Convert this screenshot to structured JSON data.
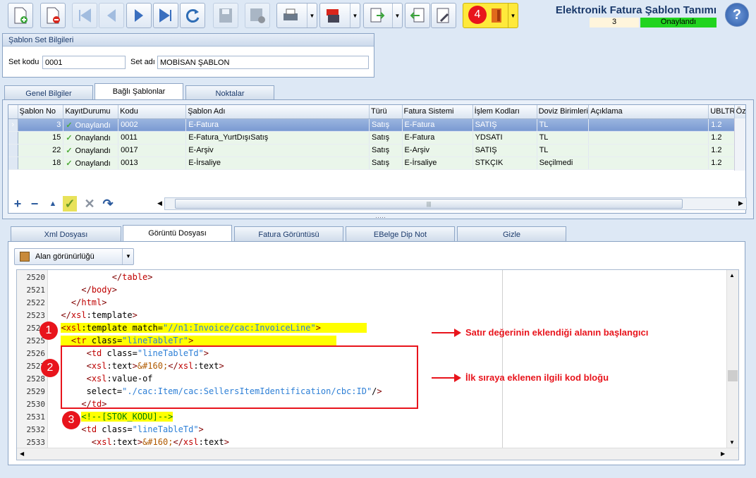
{
  "app": {
    "title": "Elektronik Fatura Şablon Tanımı",
    "record_no": "3",
    "status": "Onaylandı",
    "status_color": "#21d41f"
  },
  "toolbar": {
    "buttons": [
      "new-document-icon",
      "delete-document-icon",
      "first-record-icon",
      "previous-record-icon",
      "next-record-icon",
      "last-record-icon",
      "refresh-icon",
      "save-icon",
      "save-close-icon",
      "print-icon",
      "pdf-save-icon",
      "export-icon",
      "import-icon",
      "settings-icon",
      "exit-door-icon",
      "help-icon"
    ],
    "badge_4": "4"
  },
  "set_group": {
    "header": "Şablon Set Bilgileri",
    "set_kodu_label": "Set kodu",
    "set_kodu_value": "0001",
    "set_adi_label": "Set adı",
    "set_adi_value": "MOBİSAN ŞABLON"
  },
  "main_tabs": [
    "Genel Bilgiler",
    "Bağlı Şablonlar",
    "Noktalar"
  ],
  "grid": {
    "columns": [
      "Şablon No",
      "KayıtDurumu",
      "Kodu",
      "Şablon Adı",
      "Türü",
      "Fatura Sistemi",
      "İşlem Kodları",
      "Doviz Birimleri",
      "Açıklama",
      "UBLTR",
      "Özel I"
    ],
    "rows": [
      {
        "no": "3",
        "status": "Onaylandı",
        "code": "0002",
        "name": "E-Fatura",
        "type": "Satış",
        "system": "E-Fatura",
        "ops": "SATIŞ",
        "currency": "TL",
        "desc": "",
        "ubl": "1.2"
      },
      {
        "no": "15",
        "status": "Onaylandı",
        "code": "0011",
        "name": "E-Fatura_YurtDışıSatış",
        "type": "Satış",
        "system": "E-Fatura",
        "ops": "YDSATI",
        "currency": "TL",
        "desc": "",
        "ubl": "1.2"
      },
      {
        "no": "22",
        "status": "Onaylandı",
        "code": "0017",
        "name": "E-Arşiv",
        "type": "Satış",
        "system": "E-Arşiv",
        "ops": "SATIŞ",
        "currency": "TL",
        "desc": "",
        "ubl": "1.2"
      },
      {
        "no": "18",
        "status": "Onaylandı",
        "code": "0013",
        "name": "E-İrsaliye",
        "type": "Satış",
        "system": "E-İrsaliye",
        "ops": "STKÇIK",
        "currency": "Seçilmedi",
        "desc": "",
        "ubl": "1.2"
      }
    ]
  },
  "lower_tabs": [
    "Xml Dosyası",
    "Görüntü Dosyası",
    "Fatura Görüntüsü",
    "EBelge Dip Not",
    "Gizle"
  ],
  "alan_button": "Alan görünürlüğü",
  "editor": {
    "line_numbers": [
      "2520",
      "2521",
      "2522",
      "2523",
      "2524",
      "2525",
      "2526",
      "2527",
      "2528",
      "2529",
      "2530",
      "2531",
      "2532",
      "2533"
    ]
  },
  "annotations": {
    "badge_1": "1",
    "badge_2": "2",
    "badge_3": "3",
    "note_1": "Satır değerinin eklendiği alanın başlangıcı",
    "note_2": "İlk sıraya eklenen ilgili kod bloğu"
  }
}
